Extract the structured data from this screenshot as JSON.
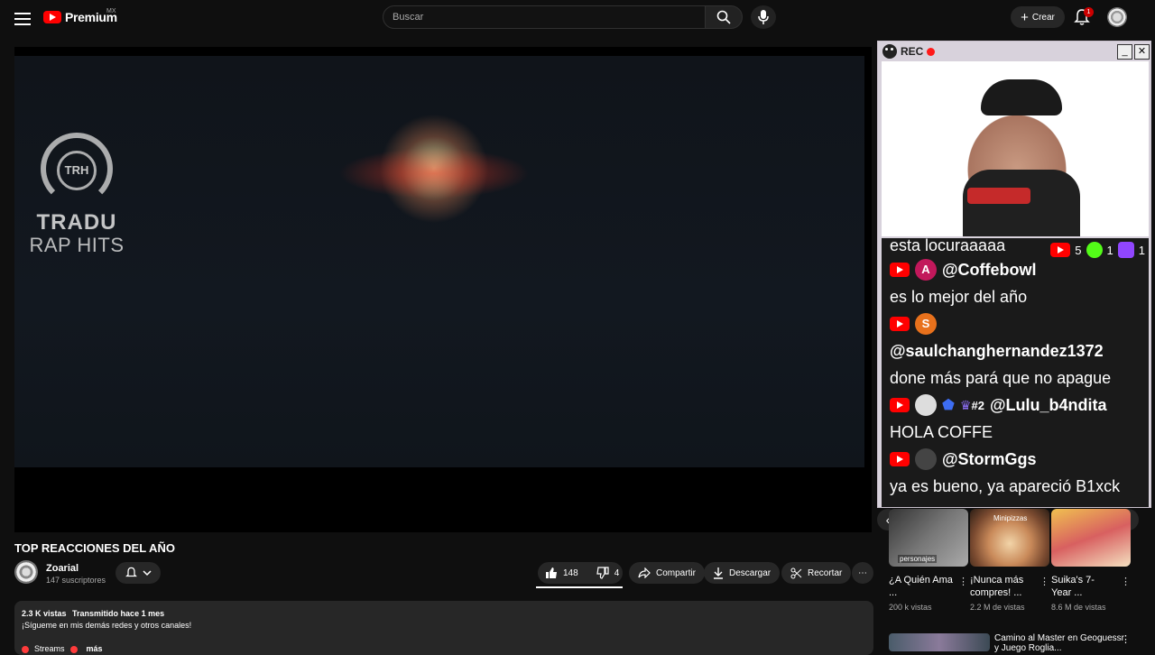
{
  "header": {
    "logo_text": "Premium",
    "logo_region": "MX",
    "search_placeholder": "Buscar",
    "create_label": "Crear",
    "notifications_count": "1"
  },
  "player": {
    "watermark_line1": "TRADU",
    "watermark_line2": "RAP HITS",
    "watermark_badge": "TRH"
  },
  "overlay": {
    "rec_label": "REC",
    "counts": [
      {
        "platform": "youtube",
        "value": "5"
      },
      {
        "platform": "kick",
        "value": "1"
      },
      {
        "platform": "twitch",
        "value": "1"
      }
    ],
    "chat": [
      {
        "type": "text",
        "text": "esta locuraaaaa"
      },
      {
        "type": "user",
        "avatar": "A",
        "avatar_color": "#c2185b",
        "user": "@Coffebowl"
      },
      {
        "type": "text",
        "text": "es lo mejor del año"
      },
      {
        "type": "user",
        "avatar": "S",
        "avatar_color": "#e8711c",
        "user": ""
      },
      {
        "type": "text",
        "text": "@saulchanghernandez1372"
      },
      {
        "type": "text",
        "text": "done más pará que no apague"
      },
      {
        "type": "user",
        "avatar": "",
        "avatar_color": "#dddddd",
        "user": "@Lulu_b4ndita",
        "rank": "#2"
      },
      {
        "type": "text",
        "text": "HOLA COFFE"
      },
      {
        "type": "user",
        "avatar": "",
        "avatar_color": "#444444",
        "user": "@StormGgs"
      },
      {
        "type": "text",
        "text": "ya es bueno, ya apareció B1xck"
      }
    ]
  },
  "recommendations": {
    "cards": [
      {
        "title": "¿A Quién Ama ...",
        "meta": "200 k vistas",
        "thumb_label": "personajes"
      },
      {
        "title": "¡Nunca más compres! ...",
        "meta": "2.2 M de vistas",
        "thumb_label": "Minipizzas"
      },
      {
        "title": "Suika's 7-Year ...",
        "meta": "8.6 M de vistas",
        "thumb_label": ""
      }
    ],
    "next_video_title": "Camino al Master en Geoguessr y Juego Roglia..."
  },
  "video": {
    "title": "TOP REACCIONES DEL AÑO",
    "channel": "Zoarial",
    "subscribers": "147 suscriptores",
    "likes": "148",
    "dislikes": "4",
    "share_label": "Compartir",
    "download_label": "Descargar",
    "clip_label": "Recortar"
  },
  "description": {
    "views": "2.3 K vistas",
    "time": "Transmitido hace 1 mes",
    "text": "¡Sígueme en mis demás redes y otros canales!",
    "link_label": "Streams",
    "more_label": "más"
  }
}
